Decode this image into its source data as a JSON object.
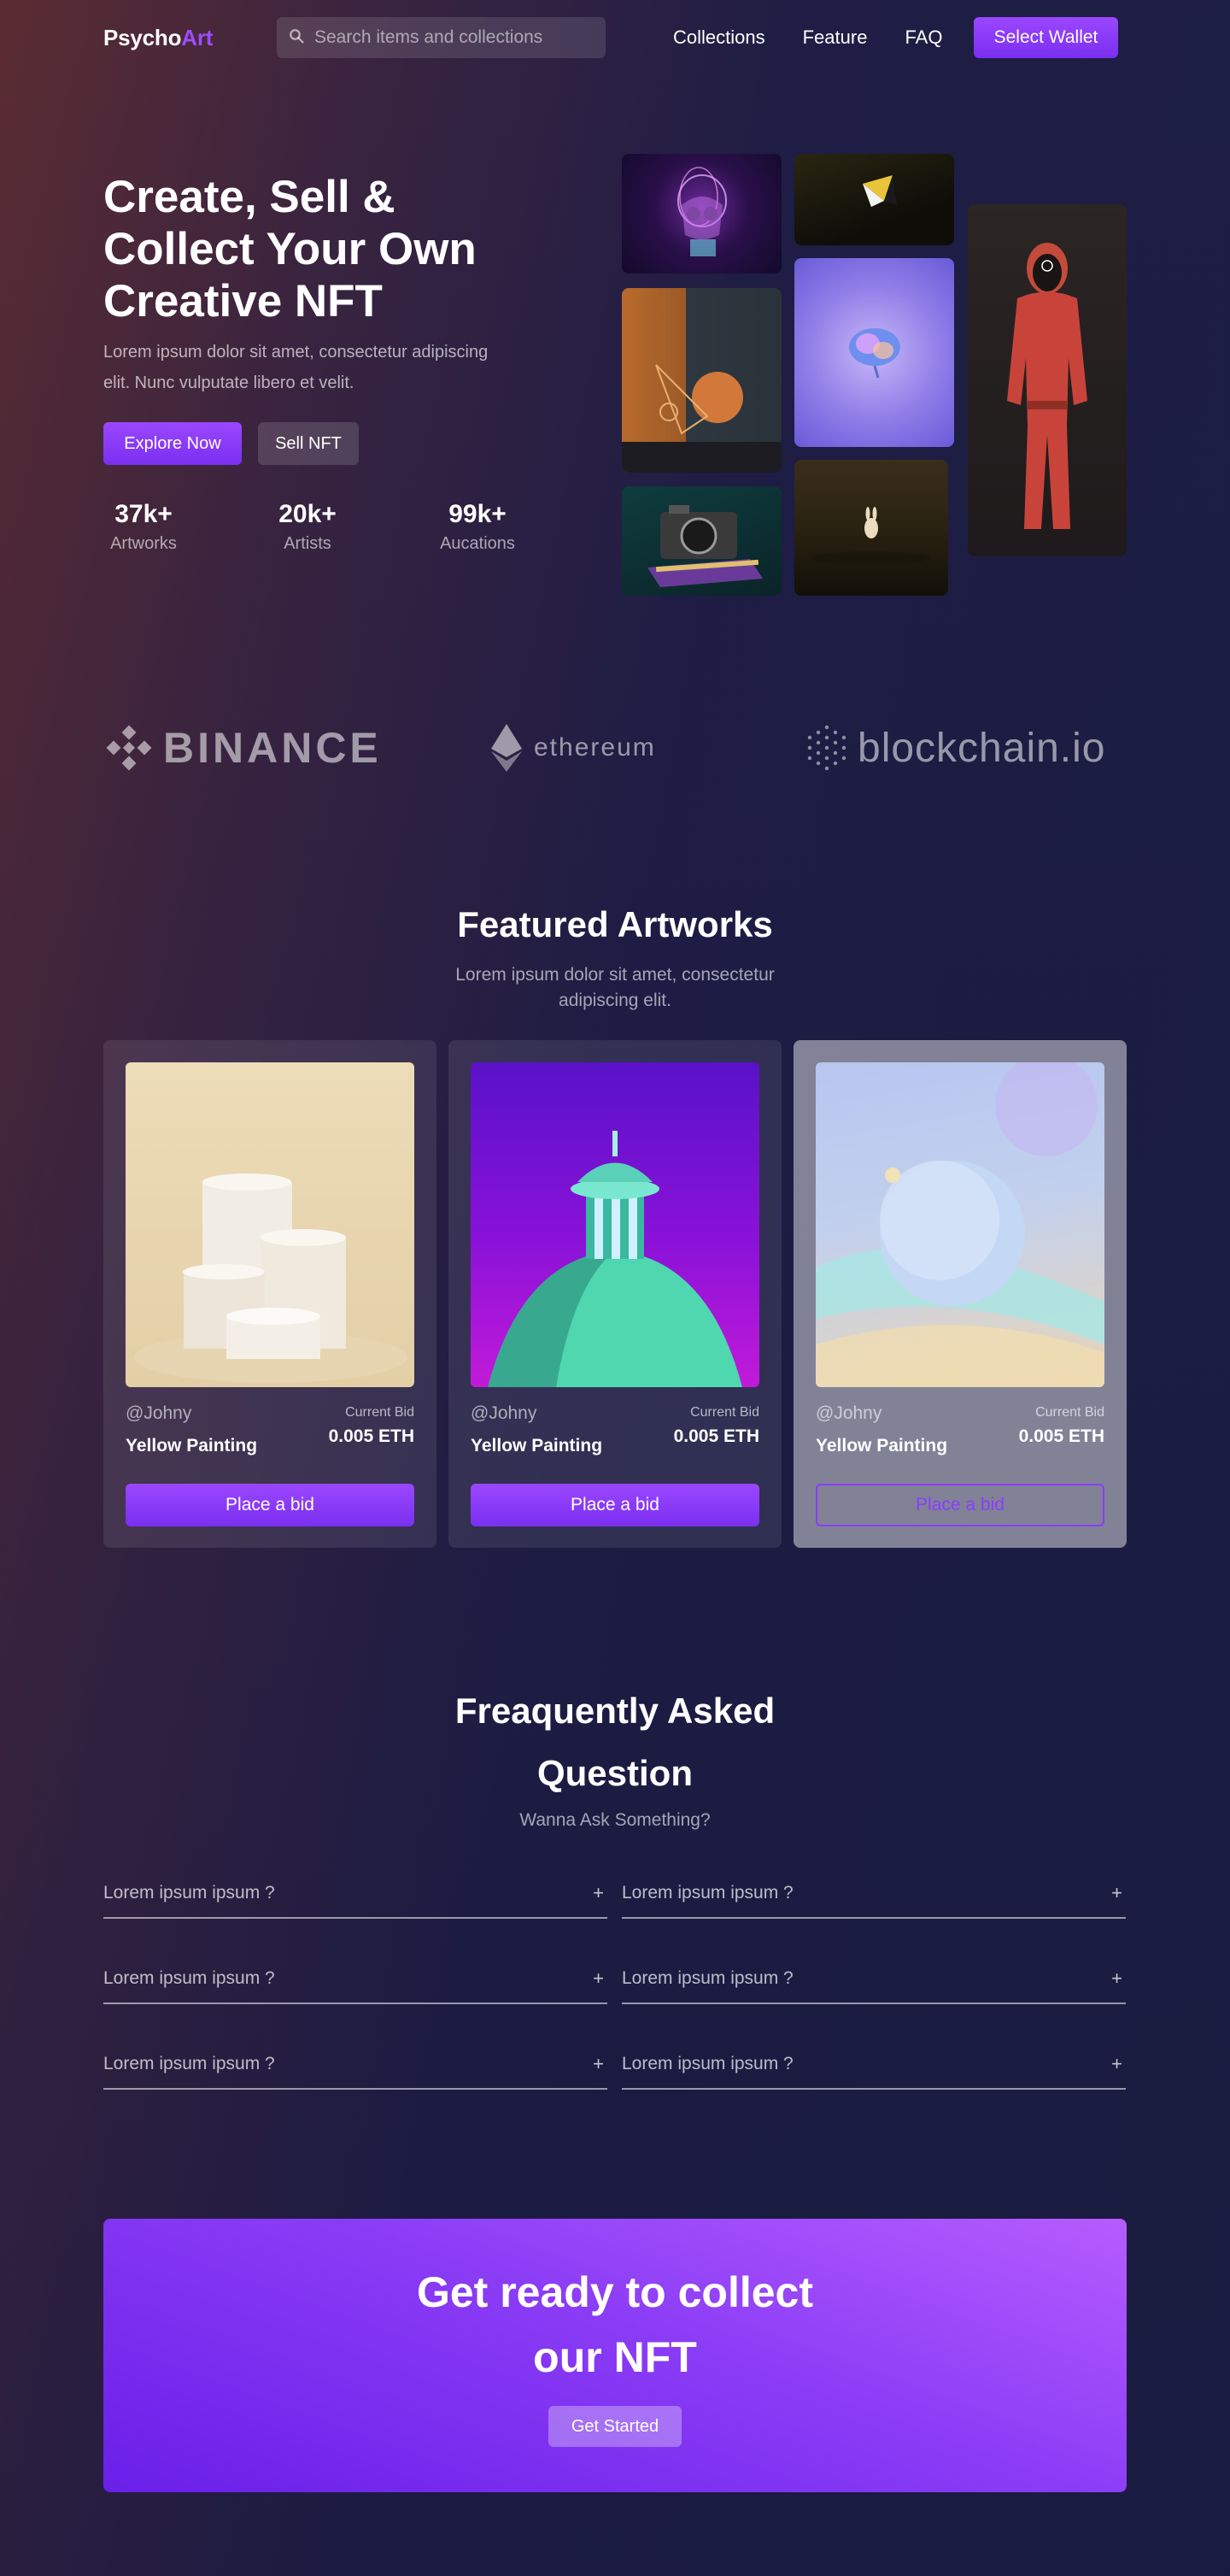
{
  "nav": {
    "logo_main": "Psycho",
    "logo_accent": "Art",
    "search_placeholder": "Search items and collections",
    "links": [
      "Collections",
      "Feature",
      "FAQ"
    ],
    "wallet_button": "Select Wallet"
  },
  "hero": {
    "title_line1": "Create, Sell &",
    "title_line2": "Collect Your Own",
    "title_line3": "Creative NFT",
    "subtitle": "Lorem ipsum dolor sit amet, consectetur adipiscing elit. Nunc vulputate libero et velit.",
    "explore_button": "Explore Now",
    "sell_button": "Sell NFT",
    "stats": [
      {
        "value": "37k+",
        "label": "Artworks"
      },
      {
        "value": "20k+",
        "label": "Artists"
      },
      {
        "value": "99k+",
        "label": "Aucations"
      }
    ]
  },
  "partners": {
    "binance": "BINANCE",
    "ethereum": "ethereum",
    "blockchain": "blockchain.io"
  },
  "featured": {
    "title": "Featured Artworks",
    "subtitle_line1": "Lorem ipsum dolor sit amet, consectetur",
    "subtitle_line2": "adipiscing elit.",
    "cards": [
      {
        "user": "@Johny",
        "name": "Yellow Painting",
        "bid_label": "Current Bid",
        "bid_value": "0.005 ETH",
        "button": "Place a bid"
      },
      {
        "user": "@Johny",
        "name": "Yellow Painting",
        "bid_label": "Current Bid",
        "bid_value": "0.005 ETH",
        "button": "Place a bid"
      },
      {
        "user": "@Johny",
        "name": "Yellow Painting",
        "bid_label": "Current Bid",
        "bid_value": "0.005 ETH",
        "button": "Place a bid"
      }
    ]
  },
  "faq": {
    "title_line1": "Freaquently Asked",
    "title_line2": "Question",
    "subtitle": "Wanna Ask Something?",
    "items": [
      "Lorem ipsum ipsum ?",
      "Lorem ipsum ipsum ?",
      "Lorem ipsum ipsum ?",
      "Lorem ipsum ipsum ?",
      "Lorem ipsum ipsum ?",
      "Lorem ipsum ipsum ?"
    ],
    "plus": "+"
  },
  "cta": {
    "title_line1": "Get ready to collect",
    "title_line2": "our NFT",
    "button": "Get Started"
  },
  "colors": {
    "accent": "#8a3cff",
    "background_dark": "#1b1e42"
  }
}
